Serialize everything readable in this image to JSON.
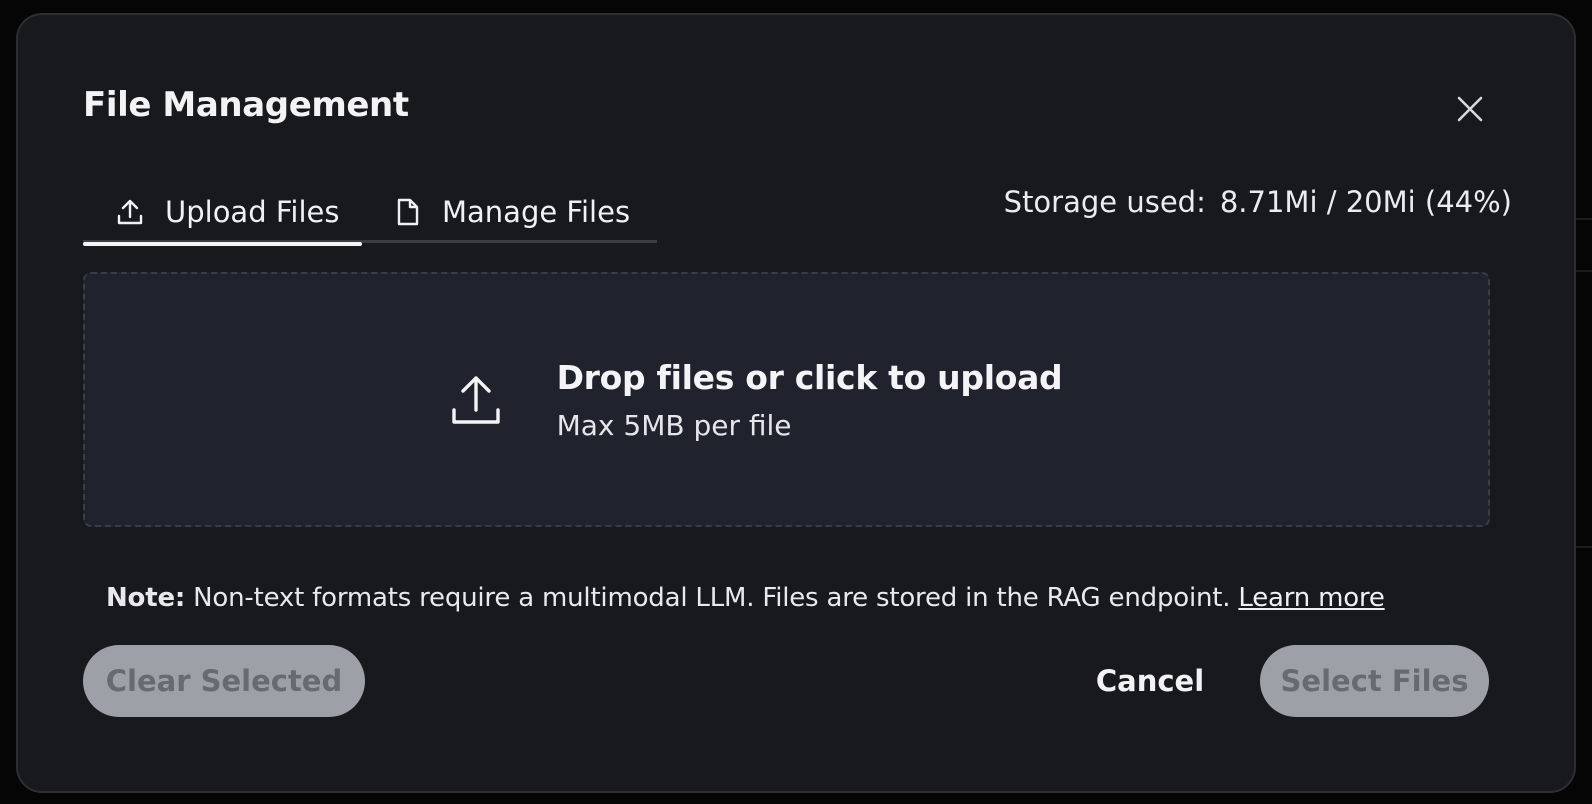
{
  "dialog": {
    "title": "File Management",
    "close_icon": "close-icon"
  },
  "tabs": [
    {
      "label": "Upload Files",
      "icon": "upload-icon",
      "active": true
    },
    {
      "label": "Manage Files",
      "icon": "file-icon",
      "active": false
    }
  ],
  "storage": {
    "label": "Storage used:",
    "value": "8.71Mi / 20Mi (44%)",
    "percent": 44
  },
  "dropzone": {
    "icon": "upload-icon",
    "title": "Drop files or click to upload",
    "subtitle": "Max 5MB per file"
  },
  "note": {
    "label": "Note:",
    "text": " Non-text formats require a multimodal LLM. Files are stored in the RAG endpoint. ",
    "link": "Learn more"
  },
  "footer": {
    "clear_label": "Clear Selected",
    "cancel_label": "Cancel",
    "select_label": "Select Files"
  },
  "colors": {
    "modal_bg": "#18191d",
    "dropzone_bg": "#20222d",
    "disabled_button_bg": "#9ea0a8",
    "disabled_button_text": "#686a72"
  }
}
